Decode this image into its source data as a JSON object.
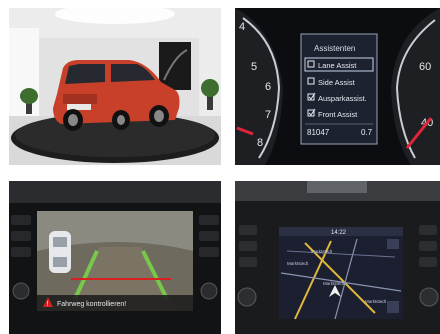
{
  "assist_menu": {
    "title": "Assistenten",
    "items": [
      {
        "label": "Lane Assist",
        "checked": false,
        "highlighted": true
      },
      {
        "label": "Side Assist",
        "checked": false,
        "highlighted": false
      },
      {
        "label": "Ausparkassist.",
        "checked": true,
        "highlighted": false
      },
      {
        "label": "Front Assist",
        "checked": true,
        "highlighted": false
      }
    ],
    "odometer": "81047",
    "trip_value": "0.7"
  },
  "speedometer_ticks": [
    "40",
    "60"
  ],
  "tachometer_ticks": [
    "4",
    "5",
    "6",
    "7",
    "8"
  ],
  "camera_warning": "Fahrweg kontrollieren!",
  "nav_screen": {
    "time": "14:22",
    "place_labels": [
      "Marktstedt",
      "Marktstedt",
      "Marktstedt",
      "Marktstedt"
    ]
  },
  "colors": {
    "menu_border": "#9aa4b4",
    "menu_bg": "#1c2230",
    "highlight": "#c8d4e8",
    "car_red": "#c9402a",
    "needle": "#e0243a",
    "guide_line": "#78c84a",
    "warning_red": "#d82020"
  }
}
